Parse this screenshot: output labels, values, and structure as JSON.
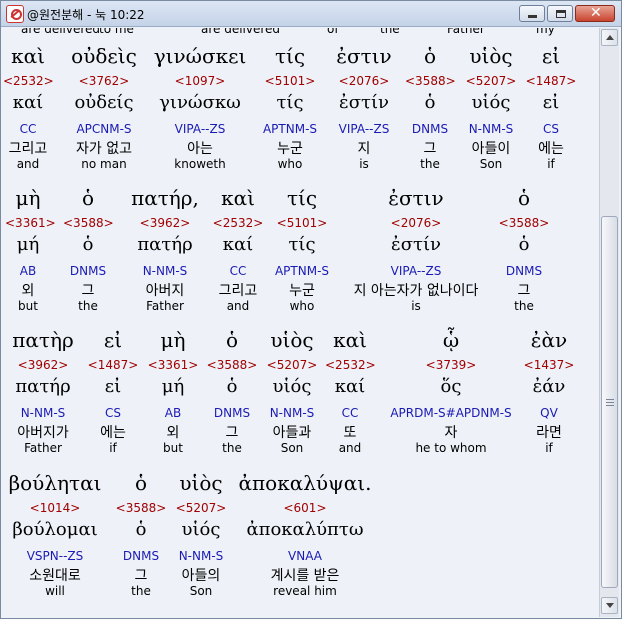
{
  "window": {
    "title": "@원전분해 - 눅 10:22"
  },
  "top_fragment": [
    "are delivered",
    "to me",
    "are delivered",
    "of",
    "the",
    "Father",
    "my"
  ],
  "lines": [
    {
      "words": [
        {
          "gk": "καὶ",
          "num": "<2532>",
          "lex": "καί",
          "parse": "CC",
          "ko": "그리고",
          "en": "and"
        },
        {
          "gk": "οὐδεὶς",
          "num": "<3762>",
          "lex": "οὐδείς",
          "parse": "APCNM-S",
          "ko": "자가 없고",
          "en": "no man"
        },
        {
          "gk": "γινώσκει",
          "num": "<1097>",
          "lex": "γινώσκω",
          "parse": "VIPA--ZS",
          "ko": "아는",
          "en": "knoweth"
        },
        {
          "gk": "τίς",
          "num": "<5101>",
          "lex": "τίς",
          "parse": "APTNM-S",
          "ko": "누군",
          "en": "who"
        },
        {
          "gk": "ἐστιν",
          "num": "<2076>",
          "lex": "ἐστίν",
          "parse": "VIPA--ZS",
          "ko": "지",
          "en": "is"
        },
        {
          "gk": "ὁ",
          "num": "<3588>",
          "lex": "ὁ",
          "parse": "DNMS",
          "ko": "그",
          "en": "the"
        },
        {
          "gk": "υἱὸς",
          "num": "<5207>",
          "lex": "υἱός",
          "parse": "N-NM-S",
          "ko": "아들이",
          "en": "Son"
        },
        {
          "gk": "εἰ",
          "num": "<1487>",
          "lex": "εἰ",
          "parse": "CS",
          "ko": "에는",
          "en": "if"
        }
      ]
    },
    {
      "words": [
        {
          "gk": "μὴ",
          "num": "<3361>",
          "lex": "μή",
          "parse": "AB",
          "ko": "외",
          "en": "but"
        },
        {
          "gk": "ὁ",
          "num": "<3588>",
          "lex": "ὁ",
          "parse": "DNMS",
          "ko": "그",
          "en": "the"
        },
        {
          "gk": "πατήρ,",
          "num": "<3962>",
          "lex": "πατήρ",
          "parse": "N-NM-S",
          "ko": "아버지",
          "en": "Father"
        },
        {
          "gk": "καὶ",
          "num": "<2532>",
          "lex": "καί",
          "parse": "CC",
          "ko": "그리고",
          "en": "and"
        },
        {
          "gk": "τίς",
          "num": "<5101>",
          "lex": "τίς",
          "parse": "APTNM-S",
          "ko": "누군",
          "en": "who"
        },
        {
          "gk": "ἐστιν",
          "num": "<2076>",
          "lex": "ἐστίν",
          "parse": "VIPA--ZS",
          "ko": "지 아는자가 없나이다",
          "en": "is"
        },
        {
          "gk": "ὁ",
          "num": "<3588>",
          "lex": "ὁ",
          "parse": "DNMS",
          "ko": "그",
          "en": "the"
        }
      ]
    },
    {
      "words": [
        {
          "gk": "πατὴρ",
          "num": "<3962>",
          "lex": "πατήρ",
          "parse": "N-NM-S",
          "ko": "아버지가",
          "en": "Father"
        },
        {
          "gk": "εἰ",
          "num": "<1487>",
          "lex": "εἰ",
          "parse": "CS",
          "ko": "에는",
          "en": "if"
        },
        {
          "gk": "μὴ",
          "num": "<3361>",
          "lex": "μή",
          "parse": "AB",
          "ko": "외",
          "en": "but"
        },
        {
          "gk": "ὁ",
          "num": "<3588>",
          "lex": "ὁ",
          "parse": "DNMS",
          "ko": "그",
          "en": "the"
        },
        {
          "gk": "υἱὸς",
          "num": "<5207>",
          "lex": "υἱός",
          "parse": "N-NM-S",
          "ko": "아들과",
          "en": "Son"
        },
        {
          "gk": "καὶ",
          "num": "<2532>",
          "lex": "καί",
          "parse": "CC",
          "ko": "또",
          "en": "and"
        },
        {
          "gk": "ᾧ",
          "num": "<3739>",
          "lex": "ὅς",
          "parse": "APRDM-S#APDNM-S",
          "ko": "자",
          "en": "he to whom"
        },
        {
          "gk": "ἐὰν",
          "num": "<1437>",
          "lex": "ἐάν",
          "parse": "QV",
          "ko": "라면",
          "en": "if"
        }
      ]
    },
    {
      "words": [
        {
          "gk": "βούληται",
          "num": "<1014>",
          "lex": "βούλομαι",
          "parse": "VSPN--ZS",
          "ko": "소원대로",
          "en": "will"
        },
        {
          "gk": "ὁ",
          "num": "<3588>",
          "lex": "ὁ",
          "parse": "DNMS",
          "ko": "그",
          "en": "the"
        },
        {
          "gk": "υἱὸς",
          "num": "<5207>",
          "lex": "υἱός",
          "parse": "N-NM-S",
          "ko": "아들의",
          "en": "Son"
        },
        {
          "gk": "ἀποκαλύψαι.",
          "num": "<601>",
          "lex": "ἀποκαλύπτω",
          "parse": "VNAA",
          "ko": "계시를 받은",
          "en": "reveal him"
        }
      ]
    }
  ]
}
